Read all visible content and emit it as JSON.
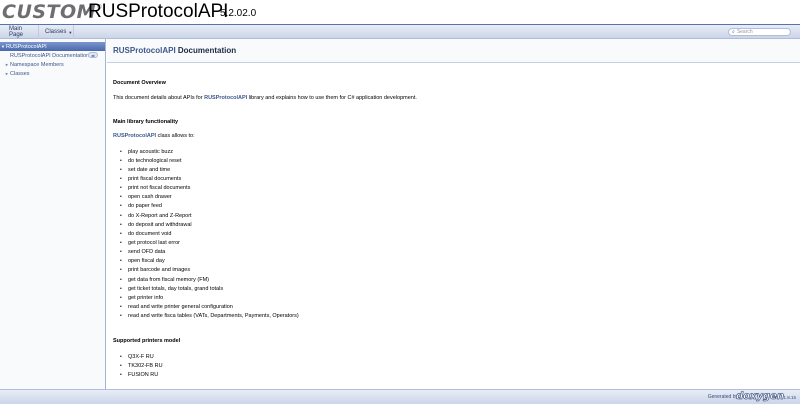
{
  "header": {
    "logo_text": "CUSTOM",
    "logo_mark": "®",
    "project_name": "RUSProtocolAPI",
    "project_number": "5.2.02.0"
  },
  "navbar": {
    "main_page": "Main Page",
    "classes": "Classes",
    "classes_caret": "▼",
    "search_icon": "magnifier-icon",
    "search_placeholder": "Search"
  },
  "sidebar": {
    "items": [
      {
        "label": "RUSProtocolAPI",
        "arrow": "▼",
        "selected": true
      },
      {
        "label": "RUSProtocolAPI Documentation",
        "arrow": "",
        "selected": false
      },
      {
        "label": "Namespace Members",
        "arrow": "►",
        "selected": false
      },
      {
        "label": "Classes",
        "arrow": "►",
        "selected": false
      }
    ],
    "sync_icon": "sync-icon"
  },
  "content": {
    "title_highlight": "RUSProtocolAPI",
    "title_rest": " Documentation",
    "overview_heading": "Document Overview",
    "overview_pre": "This document details about APIs for ",
    "overview_link": "RUSProtocolAPI",
    "overview_post": " library and explains how to use them for C# application development.",
    "main_heading": "Main library functionality",
    "class_link": "RUSProtocolAPI",
    "class_post": " class allows to:",
    "functions": [
      "play acoustic buzz",
      "do technological reset",
      "set date and time",
      "print fiscal documents",
      "print not fiscal documents",
      "open cash drawer",
      "do paper feed",
      "do X-Report and Z-Report",
      "do deposit and withdrawal",
      "do document void",
      "get protocol last error",
      "send OFD data",
      "open fiscal day",
      "print barcode and images",
      "get data from fiscal memory (FM)",
      "get ticket totals, day totals, grand totals",
      "get printer info",
      "read and write printer general configuration",
      "read and write fisca tables (VATs, Departments, Payments, Operators)"
    ],
    "printers_heading": "Supported printers model",
    "printers": [
      "Q3X-F RU",
      "TK302-FB RU",
      "FUSION RU"
    ]
  },
  "footer": {
    "generated_by": "Generated by",
    "doxygen": "doxygen",
    "version": "1.8.15"
  },
  "colors": {
    "accent": "#3d578c",
    "nav_bg": "#cbd5e9",
    "selected": "#4a68aa"
  }
}
